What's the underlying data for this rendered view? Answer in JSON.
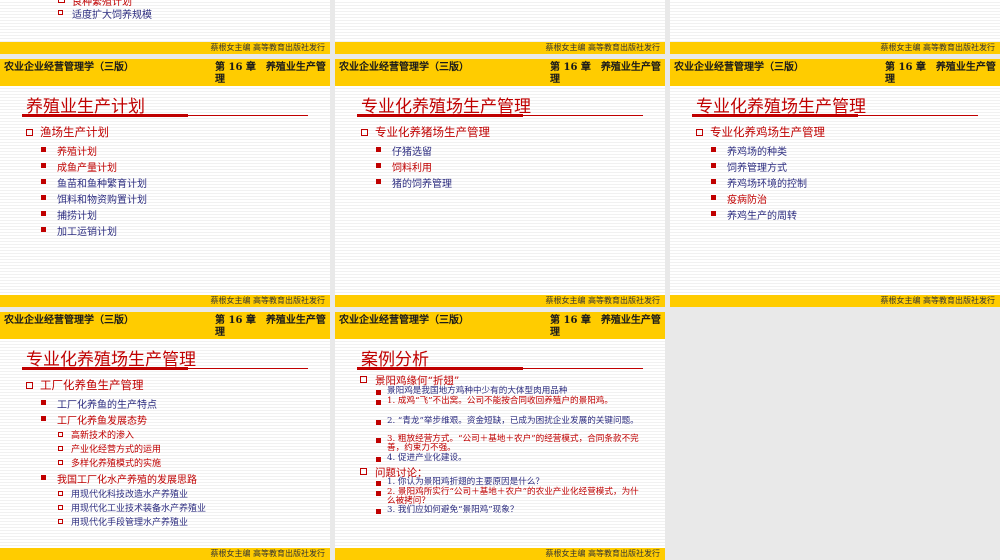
{
  "common": {
    "book_title": "农业企业经营管理学（三版）",
    "chapter": "第 16 章　养殖业生产管理",
    "footer": "蔡根女主编 高等教育出版社发行"
  },
  "top_partial": {
    "cut_item": "良种繁殖计划",
    "item": "适度扩大饲养规模"
  },
  "slide1": {
    "title": "养殖业生产计划",
    "heading": "渔场生产计划",
    "items": [
      "养殖计划",
      "成鱼产量计划",
      "鱼苗和鱼种繁育计划",
      "饵料和物资购置计划",
      "捕捞计划",
      "加工运销计划"
    ]
  },
  "slide2": {
    "title": "专业化养殖场生产管理",
    "heading": "专业化养猪场生产管理",
    "items": [
      "仔猪选留",
      "饲料利用",
      "猪的饲养管理"
    ]
  },
  "slide3": {
    "title": "专业化养殖场生产管理",
    "heading": "专业化养鸡场生产管理",
    "items": [
      "养鸡场的种类",
      "饲养管理方式",
      "养鸡场环境的控制",
      "疫病防治",
      "养鸡生产的周转"
    ]
  },
  "slide4": {
    "title": "专业化养殖场生产管理",
    "heading": "工厂化养鱼生产管理",
    "sub1": "工厂化养鱼的生产特点",
    "sub2": "工厂化养鱼发展态势",
    "sub2_items": [
      "高新技术的渗入",
      "产业化经营方式的运用",
      "多样化养殖模式的实施"
    ],
    "sub3": "我国工厂化水产养殖的发展思路",
    "sub3_items": [
      "用现代化科技改造水产养殖业",
      "用现代化工业技术装备水产养殖业",
      "用现代化手段管理水产养殖业"
    ]
  },
  "slide5": {
    "title": "案例分析",
    "heading1": "景阳鸡缘何“折翅”",
    "h1_items": [
      "景阳鸡是我国地方鸡种中少有的大体型肉用品种",
      "1. 成鸡“飞”不出窝。公司不能按合同收回养殖户的景阳鸡。",
      "2. “青龙”举步维艰。资金短缺，已成为困扰企业发展的关键问题。",
      "3. 粗放经营方式。“公司＋基地＋农户”的经营模式，合同条款不完善，约束力不强。",
      "4. 促进产业化建设。"
    ],
    "heading2": "问题讨论：",
    "h2_items": [
      "1. 你认为景阳鸡折翅的主要原因是什么？",
      "2. 景阳鸡所实行“公司＋基地＋农户”的农业产业化经营模式，为什么被拷问？",
      "3. 我们应如何避免“景阳鸡”现象？"
    ]
  }
}
